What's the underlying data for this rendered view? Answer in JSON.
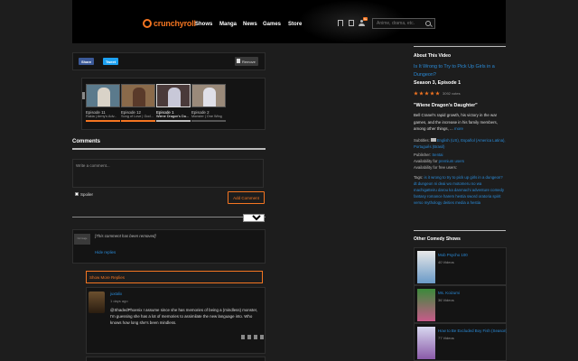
{
  "header": {
    "logo_text": "crunchyroll",
    "nav": [
      "Shows",
      "Manga",
      "News",
      "Games",
      "Store"
    ],
    "notif_count": "9+",
    "search_placeholder": "Anime, drama, etc."
  },
  "share": {
    "facebook": "Share",
    "twitter": "Tweet",
    "remove": "Remove"
  },
  "episodes": [
    {
      "title": "Episode 11",
      "subtitle": "Rakia | Army's Adv...",
      "current": false
    },
    {
      "title": "Episode 12",
      "subtitle": "Song of Love | God...",
      "current": false
    },
    {
      "title": "Episode 1",
      "subtitle": "Wiene Dragon's Da...",
      "current": true
    },
    {
      "title": "Episode 2",
      "subtitle": "Monster | One Wing",
      "current": false
    }
  ],
  "comments": {
    "title": "Comments",
    "placeholder": "Write a comment...",
    "spoiler": "Spoiler",
    "add_button": "Add Comment",
    "sort": "Top",
    "removed_avatar": "No Image",
    "removed_text": "[This comment has been removed]",
    "hide_replies": "Hide replies",
    "show_more": "Show More Replies",
    "reply": {
      "name": "juxtalix",
      "time": "1 days ago",
      "body": "@ShadedPhoenix I assume since she has memories of being a (mindless) monster, I'm guessing she has a lot of memories to assimilate the new language into. Who knows how long she's been mindless."
    }
  },
  "about": {
    "title": "About This Video",
    "show_link": "Is It Wrong to Try to Pick Up Girls in a Dungeon?",
    "season": "Season 3, Episode 1",
    "votes": "3092 votes",
    "episode_name": "\"Wiene Dragon's Daughter\"",
    "description": "Bell Cranel's rapid growth, his victory in the war games, and the increase in his family members, among other things, ...",
    "more": "more",
    "subtitles_label": "Subtitles:",
    "subtitles_value": "English (US), Español (America Latina), Português (Brasil)",
    "publisher_label": "Publisher:",
    "publisher_value": "Sentai",
    "availability1": "Availability for",
    "availability1_link": "premium users",
    "availability2": "Availability for free users:",
    "tags_label": "Tags:",
    "tags": "is it wrong to try to pick up girls in a dungeon?  dt  dungeon ni deai wo motomeru no wa machigatteiru darou ka  danmachi  adventure  comedy  fantasy  romance  harem  hestia  sword oratoria  spirit  verso  mythology  deities  media  a  hestia"
  },
  "other": {
    "title": "Other Comedy Shows",
    "shows": [
      {
        "name": "Mob Psycho 100",
        "videos": "40 Videos"
      },
      {
        "name": "Ms. Koizumi",
        "videos": "36 Videos"
      },
      {
        "name": "How to Be Excluded Boy Fish (Season)",
        "videos": "77 Videos"
      }
    ]
  }
}
